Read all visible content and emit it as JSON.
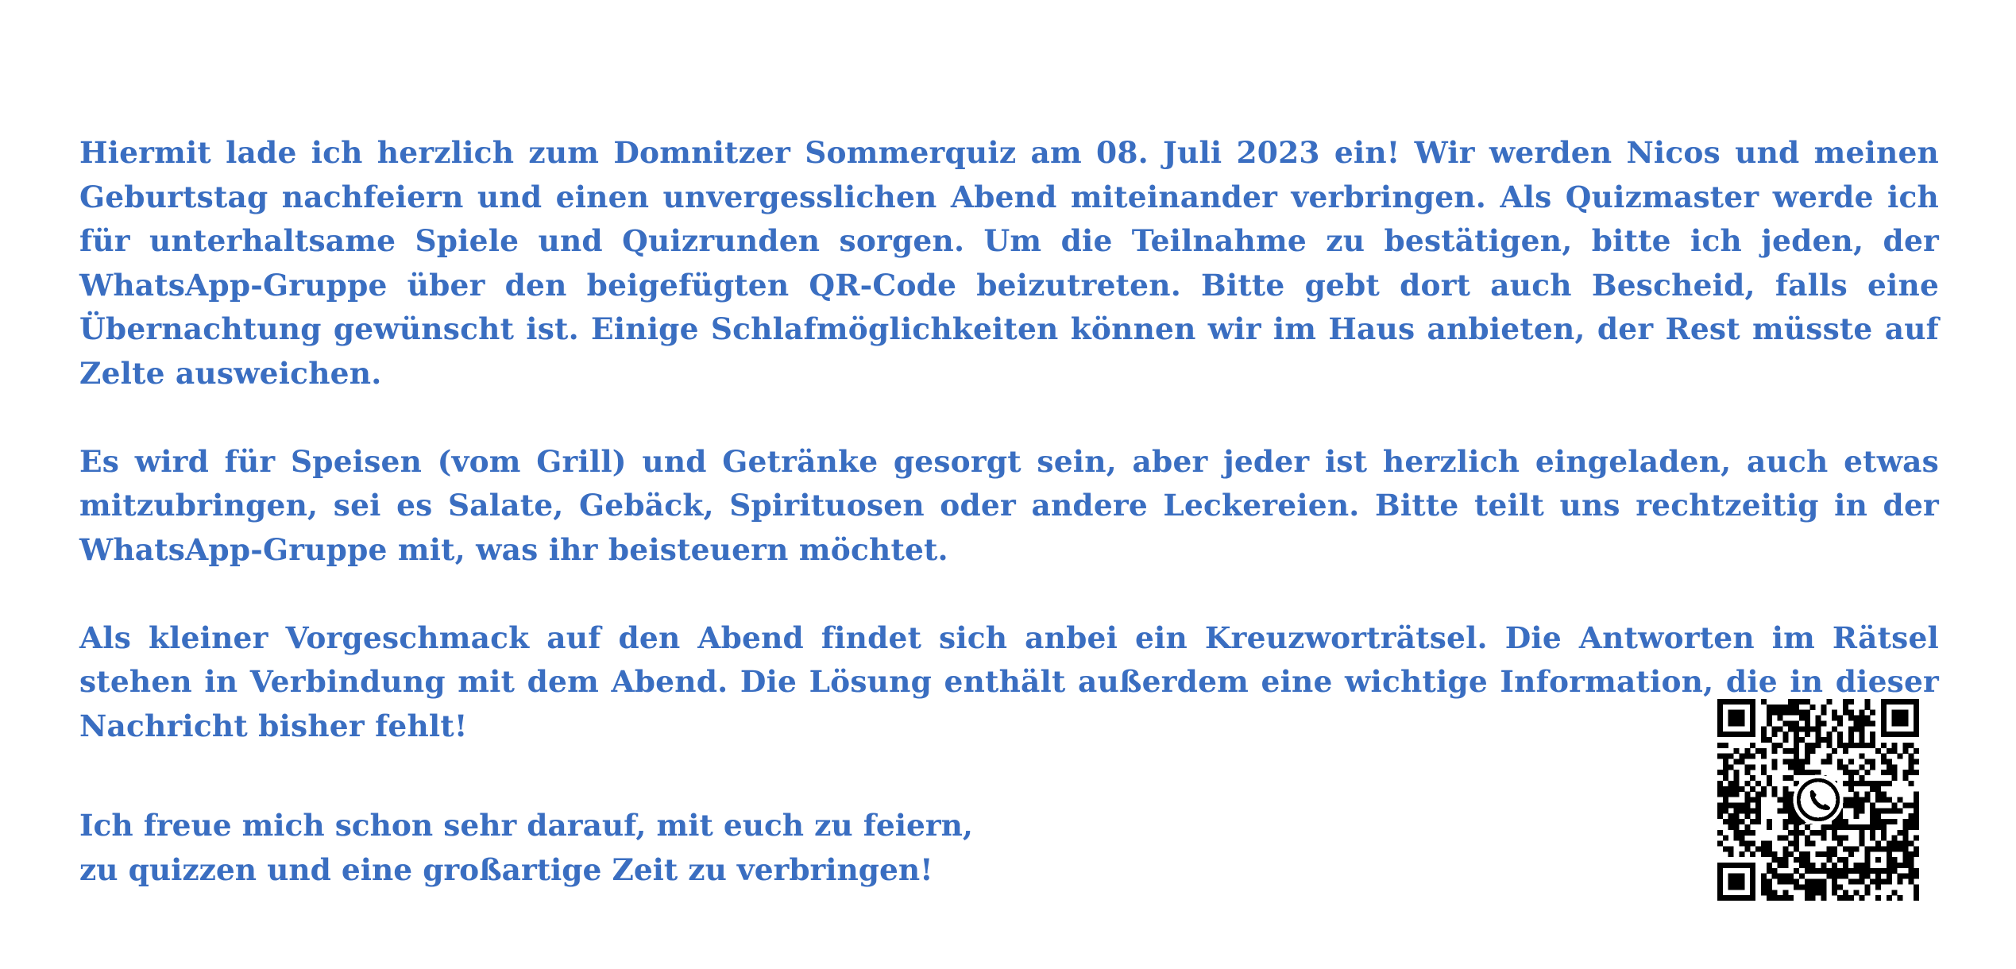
{
  "letter": {
    "paragraphs": [
      "Hiermit lade ich herzlich zum Domnitzer Sommerquiz am 08. Juli 2023 ein! Wir werden Nicos und meinen Geburtstag nachfeiern und einen unvergesslichen Abend miteinander verbringen. Als Quizmaster werde ich für unterhaltsame Spiele und Quizrunden sorgen. Um die Teilnahme zu bestätigen, bitte ich jeden, der WhatsApp-Gruppe über den beigefügten QR-Code beizutreten. Bitte gebt dort auch Bescheid, falls eine Übernachtung gewünscht ist. Einige Schlafmöglichkeiten können wir im Haus anbieten, der Rest müsste auf Zelte ausweichen.",
      "Es wird für Speisen (vom Grill) und Getränke gesorgt sein, aber jeder ist herzlich eingeladen, auch etwas mitzubringen, sei es Salate, Gebäck, Spirituosen oder andere Leckereien. Bitte teilt uns rechtzeitig in der WhatsApp-Gruppe mit, was ihr beisteuern möchtet.",
      "Als kleiner Vorgeschmack auf den Abend findet sich anbei ein Kreuzworträtsel. Die Antworten im Rätsel stehen in Verbindung mit dem Abend. Die Lösung enthält außerdem eine wichtige Information, die in dieser Nachricht bisher fehlt!"
    ],
    "closing_lines": [
      "Ich freue mich schon sehr darauf, mit euch zu feiern,",
      "zu quizzen und eine großartige Zeit zu verbringen!"
    ]
  },
  "qr_code": {
    "icon": "whatsapp-icon",
    "color": "#000000"
  },
  "colors": {
    "text": "#3a6ec1",
    "background": "#ffffff"
  }
}
